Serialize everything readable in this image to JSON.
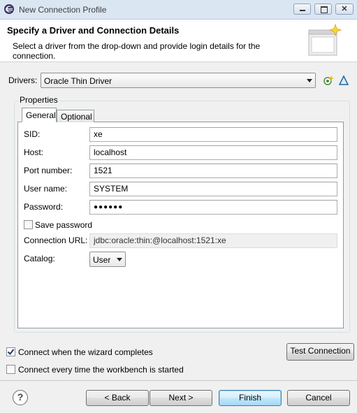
{
  "window": {
    "title": "New Connection Profile"
  },
  "banner": {
    "title": "Specify a Driver and Connection Details",
    "description": "Select a driver from the drop-down and provide login details for the connection."
  },
  "drivers": {
    "label": "Drivers:",
    "selected": "Oracle Thin Driver"
  },
  "properties": {
    "group_label": "Properties",
    "tabs": [
      {
        "label": "General",
        "active": true
      },
      {
        "label": "Optional",
        "active": false
      }
    ],
    "fields": {
      "sid": {
        "label": "SID:",
        "value": "xe"
      },
      "host": {
        "label": "Host:",
        "value": "localhost"
      },
      "port": {
        "label": "Port number:",
        "value": "1521"
      },
      "user": {
        "label": "User name:",
        "value": "SYSTEM"
      },
      "password": {
        "label": "Password:",
        "value": "●●●●●●"
      }
    },
    "save_password": {
      "label": "Save password",
      "checked": false
    },
    "connection_url": {
      "label": "Connection URL:",
      "value": "jdbc:oracle:thin:@localhost:1521:xe"
    },
    "catalog": {
      "label": "Catalog:",
      "selected": "User"
    }
  },
  "options": {
    "connect_on_complete": {
      "label": "Connect when the wizard completes",
      "checked": true
    },
    "connect_on_start": {
      "label": "Connect every time the workbench is started",
      "checked": false
    }
  },
  "buttons": {
    "test_connection": "Test Connection",
    "back": "< Back",
    "next": "Next >",
    "finish": "Finish",
    "cancel": "Cancel",
    "help": "?"
  }
}
